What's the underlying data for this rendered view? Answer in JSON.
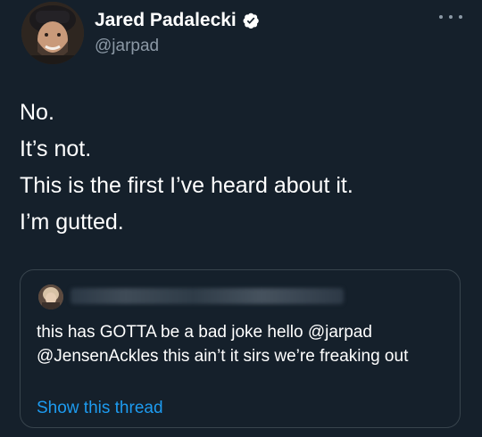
{
  "author": {
    "name": "Jared Padalecki",
    "handle": "@jarpad",
    "verified_icon": "verified-badge-icon",
    "avatar_icon": "avatar-photo"
  },
  "more_icon": "more-options-icon",
  "tweet_lines": [
    "No.",
    "It’s not.",
    "This is the first I’ve heard about it.",
    "I’m gutted."
  ],
  "quoted_tweet": {
    "author_name_redacted": true,
    "text": "this has GOTTA be a bad joke hello @jarpad @JensenAckles this ain’t it sirs we’re freaking out",
    "show_thread_label": "Show this thread"
  },
  "colors": {
    "background": "#15202b",
    "text_primary": "#ffffff",
    "text_secondary": "#8b98a5",
    "link": "#1d9bf0",
    "verified": "#ffffff",
    "border": "#38444d"
  }
}
